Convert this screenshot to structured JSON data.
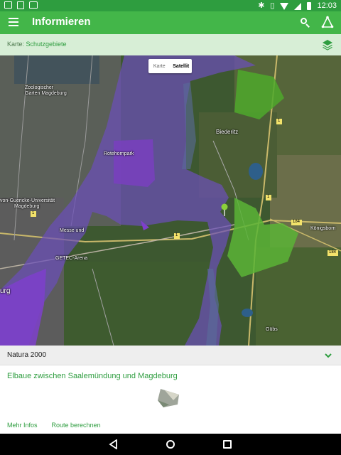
{
  "status_bar": {
    "time": "12:03",
    "left_icons": [
      "notification-square-icon",
      "phone-icon",
      "bag-icon"
    ],
    "right_icons": [
      "bluetooth-icon",
      "vibrate-icon",
      "wifi-icon",
      "signal-icon",
      "battery-icon"
    ]
  },
  "app_bar": {
    "title": "Informieren",
    "icons": [
      "menu-icon",
      "search-icon",
      "route-icon"
    ]
  },
  "layer_bar": {
    "label": "Karte: ",
    "value": "Schutzgebiete",
    "icon": "layers-icon"
  },
  "map": {
    "toggle": {
      "options": [
        "Karte",
        "Satellit"
      ],
      "selected": "Satellit"
    },
    "labels": {
      "zoo_1": "Zoologischer",
      "zoo_2": "Garten Magdeburg",
      "rotehornpark": "Rotehornpark",
      "biederitz": "Biederitz",
      "otto_uni_1": "von-Guericke-Universität",
      "otto_uni_2": "Magdeburg",
      "messe": "Messe und",
      "getec": "GETEC-Arena",
      "koenigsborn": "Königsborn",
      "guebs": "Gübs",
      "burg": "urg",
      "road_184_a": "184",
      "road_184_b": "184",
      "road_1_a": "1",
      "road_1_b": "1",
      "road_1_c": "1",
      "road_1_d": "1"
    },
    "colors": {
      "natura_purple": "#6b4fb8",
      "protected_green": "#4ea82b"
    }
  },
  "panel": {
    "category": "Natura 2000",
    "area_name": "Elbaue zwischen Saalemündung und Magdeburg",
    "actions": [
      "Mehr Infos",
      "Route berechnen"
    ]
  },
  "nav_bar": {
    "icons": [
      "back-icon",
      "home-icon",
      "recents-icon"
    ]
  },
  "colors": {
    "primary": "#43b649",
    "primary_dark": "#2e9d3f",
    "layer_bg": "#d7eed6"
  }
}
